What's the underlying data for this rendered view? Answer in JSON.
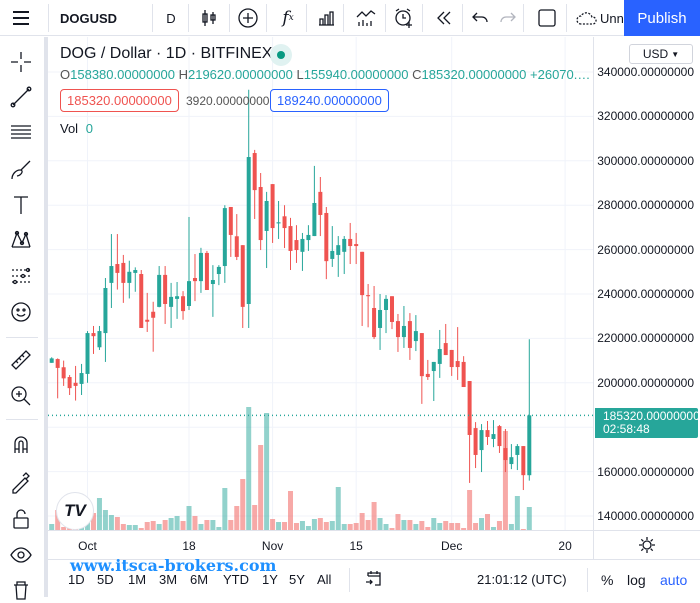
{
  "toolbar": {
    "symbol": "DOGUSD",
    "interval": "D",
    "unnamed": "Unn",
    "publish": "Publish",
    "icons": [
      "menu-icon",
      "candles-icon",
      "add-symbol-icon",
      "indicators-icon",
      "bar-chart-icon",
      "compare-icon",
      "alert-icon",
      "replay-icon",
      "undo-icon",
      "redo-icon",
      "layout-icon",
      "cloud-icon"
    ]
  },
  "left_tools": [
    "crosshair",
    "trend-line",
    "horizontal-lines",
    "brush",
    "text",
    "pattern",
    "prediction",
    "emoji",
    "ruler",
    "zoom-in",
    "magnet",
    "lock-drawing",
    "lock",
    "eye"
  ],
  "legend": {
    "title": "DOG / Dollar · 1D · BITFINEX",
    "o_label": "O",
    "o": "158380.00000000",
    "h_label": "H",
    "h": "219620.00000000",
    "l_label": "L",
    "l": "155940.00000000",
    "c_label": "C",
    "c": "185320.00000000",
    "change": "+26070.…",
    "sell": "185320.00000000",
    "spread": "3920.00000000",
    "buy": "189240.00000000",
    "vol_label": "Vol",
    "vol_value": "0"
  },
  "price_axis": {
    "currency": "USD",
    "last_price": "185320.00000000",
    "countdown": "02:58:48"
  },
  "bottom": {
    "ranges": [
      "1D",
      "5D",
      "1M",
      "3M",
      "6M",
      "YTD",
      "1Y",
      "5Y",
      "All"
    ],
    "time": "21:01:12 (UTC)",
    "percent": "%",
    "log": "log",
    "auto": "auto",
    "watermark": "www.itsca-brokers.com"
  },
  "colors": {
    "up": "#26a69a",
    "down": "#ef5350",
    "accent": "#2962ff"
  },
  "chart_data": {
    "type": "candlestick",
    "ylim": [
      130000,
      350000
    ],
    "y_ticks": [
      "340000.00000000",
      "320000.00000000",
      "300000.00000000",
      "280000.00000000",
      "260000.00000000",
      "240000.00000000",
      "220000.00000000",
      "200000.00000000",
      "180000.00000000",
      "160000.00000000",
      "140000.00000000"
    ],
    "x_ticks": [
      {
        "label": "Oct",
        "candle": 6
      },
      {
        "label": "18",
        "candle": 23
      },
      {
        "label": "Nov",
        "candle": 37
      },
      {
        "label": "15",
        "candle": 51
      },
      {
        "label": "Dec",
        "candle": 67
      },
      {
        "label": "20",
        "candle": 86
      }
    ],
    "grid": true,
    "last_price": 185320,
    "ohlc": [
      [
        209000,
        211500,
        209000,
        211000
      ],
      [
        210700,
        211000,
        193000,
        206700
      ],
      [
        207000,
        210000,
        198600,
        202000
      ],
      [
        202600,
        203500,
        194500,
        197600
      ],
      [
        200000,
        207600,
        192000,
        198600
      ],
      [
        199500,
        208500,
        194500,
        204400
      ],
      [
        204000,
        223300,
        200000,
        222400
      ],
      [
        222400,
        225600,
        213000,
        221000
      ],
      [
        216000,
        225600,
        214800,
        223300
      ],
      [
        222400,
        247200,
        209400,
        242700
      ],
      [
        245000,
        267000,
        233700,
        252600
      ],
      [
        253500,
        267000,
        242000,
        249500
      ],
      [
        254000,
        257600,
        236000,
        245000
      ],
      [
        245000,
        255000,
        238000,
        250000
      ],
      [
        249500,
        252000,
        241000,
        250800
      ],
      [
        249000,
        250800,
        224700,
        224700
      ],
      [
        228400,
        240500,
        222900,
        227500
      ],
      [
        232000,
        236500,
        214000,
        229300
      ],
      [
        234200,
        252600,
        234000,
        248600
      ],
      [
        248600,
        252600,
        226500,
        235500
      ],
      [
        234200,
        245000,
        224700,
        238700
      ],
      [
        237800,
        245400,
        228800,
        239000
      ],
      [
        239000,
        241300,
        228400,
        232300
      ],
      [
        234600,
        274700,
        232800,
        245800
      ],
      [
        247200,
        258000,
        236800,
        245800
      ],
      [
        245800,
        260800,
        240500,
        258500
      ],
      [
        258500,
        259400,
        241800,
        241800
      ],
      [
        244500,
        253000,
        229700,
        246300
      ],
      [
        249000,
        253000,
        244000,
        252200
      ],
      [
        252600,
        280000,
        245000,
        278700
      ],
      [
        279200,
        279200,
        256700,
        266600
      ],
      [
        266000,
        276000,
        255300,
        256700
      ],
      [
        262000,
        262000,
        224700,
        234200
      ],
      [
        235500,
        332000,
        224700,
        301700
      ],
      [
        303500,
        304900,
        273800,
        286800
      ],
      [
        288200,
        294500,
        259800,
        264300
      ],
      [
        268400,
        286000,
        251700,
        281900
      ],
      [
        289500,
        289500,
        263000,
        269700
      ],
      [
        271800,
        281900,
        264800,
        272300
      ],
      [
        275000,
        280000,
        260700,
        269700
      ],
      [
        270600,
        274300,
        250800,
        259400
      ],
      [
        264300,
        271000,
        254000,
        259800
      ],
      [
        259000,
        267500,
        250400,
        264800
      ],
      [
        264300,
        271000,
        259400,
        266600
      ],
      [
        266100,
        297700,
        266100,
        281000
      ],
      [
        286000,
        292700,
        266100,
        275600
      ],
      [
        276500,
        279200,
        246700,
        254800
      ],
      [
        255800,
        270600,
        252200,
        259400
      ],
      [
        257600,
        266100,
        247700,
        262000
      ],
      [
        259000,
        266100,
        249000,
        264800
      ],
      [
        264800,
        272000,
        253500,
        261600
      ],
      [
        262500,
        267500,
        253500,
        261600
      ],
      [
        259000,
        259000,
        225600,
        239500
      ],
      [
        239500,
        244500,
        225000,
        239000
      ],
      [
        233700,
        243600,
        219700,
        220600
      ],
      [
        224700,
        240000,
        214800,
        232800
      ],
      [
        232800,
        239500,
        222400,
        237800
      ],
      [
        239000,
        239000,
        224200,
        227400
      ],
      [
        227800,
        231000,
        213900,
        220600
      ],
      [
        220600,
        234600,
        215700,
        225600
      ],
      [
        227800,
        231400,
        210300,
        215700
      ],
      [
        218800,
        230500,
        214300,
        223300
      ],
      [
        222400,
        222400,
        190500,
        203000
      ],
      [
        204000,
        210300,
        201300,
        202600
      ],
      [
        205300,
        209400,
        191800,
        209400
      ],
      [
        208500,
        223800,
        202200,
        215200
      ],
      [
        217900,
        226500,
        212500,
        212500
      ],
      [
        214800,
        214800,
        203100,
        207100
      ],
      [
        209800,
        225100,
        201300,
        207100
      ],
      [
        209400,
        212000,
        198100,
        198100
      ],
      [
        200800,
        200800,
        154900,
        176500
      ],
      [
        179600,
        182300,
        161600,
        167500
      ],
      [
        169700,
        181400,
        159800,
        178700
      ],
      [
        178700,
        182800,
        172000,
        175600
      ],
      [
        174700,
        183200,
        171000,
        176900
      ],
      [
        180500,
        181000,
        168400,
        171500
      ],
      [
        170600,
        179200,
        159800,
        165200
      ],
      [
        163400,
        172400,
        161100,
        166500
      ],
      [
        167500,
        172400,
        160700,
        171500
      ],
      [
        171500,
        171500,
        151700,
        158400
      ],
      [
        158380,
        219620,
        155940,
        185320
      ]
    ],
    "volume_relative": [
      6,
      20,
      3,
      3,
      6,
      8,
      14,
      17,
      32,
      20,
      15,
      13,
      6,
      5,
      5,
      2,
      8,
      9,
      6,
      10,
      12,
      14,
      9,
      24,
      14,
      6,
      10,
      10,
      3,
      42,
      10,
      24,
      51,
      123,
      25,
      85,
      117,
      11,
      8,
      8,
      39,
      7,
      9,
      4,
      11,
      12,
      8,
      9,
      43,
      6,
      6,
      7,
      17,
      10,
      28,
      12,
      6,
      2,
      16,
      10,
      10,
      6,
      9,
      3,
      12,
      7,
      9,
      7,
      7,
      2,
      40,
      7,
      12,
      16,
      3,
      9,
      99,
      6,
      34,
      1,
      23
    ]
  }
}
